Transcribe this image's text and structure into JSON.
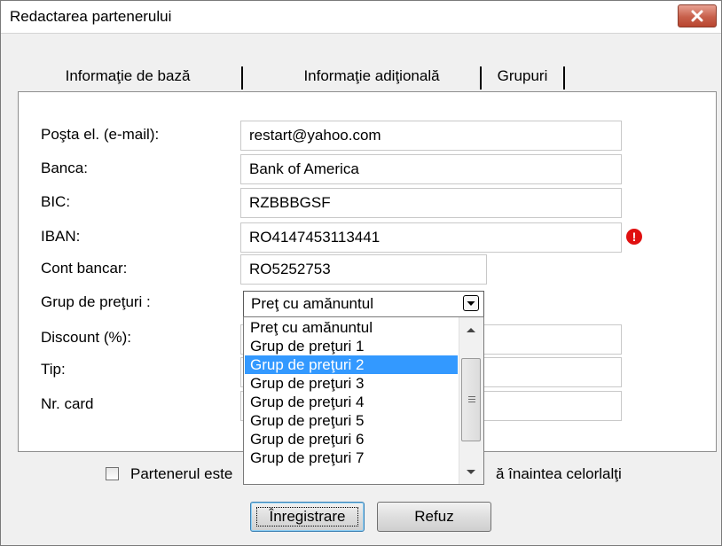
{
  "window": {
    "title": "Redactarea partenerului"
  },
  "tabs": [
    {
      "label": "Informaţie de bază"
    },
    {
      "label": "Informaţie adiţională"
    },
    {
      "label": "Grupuri"
    }
  ],
  "form": {
    "email": {
      "label": "Poşta el. (e-mail):",
      "value": "restart@yahoo.com"
    },
    "bank": {
      "label": "Banca:",
      "value": "Bank of America"
    },
    "bic": {
      "label": "BIC:",
      "value": "RZBBBGSF"
    },
    "iban": {
      "label": "IBAN:",
      "value": "RO4147453113441",
      "error_icon": "!"
    },
    "account": {
      "label": "Cont bancar:",
      "value": "RO5252753"
    },
    "price_group": {
      "label": "Grup de preţuri :",
      "value": "Preţ cu amănuntul"
    },
    "discount": {
      "label": "Discount (%):"
    },
    "type": {
      "label": "Tip:"
    },
    "card": {
      "label": "Nr. card"
    }
  },
  "dropdown": {
    "options": [
      "Preţ cu amănuntul",
      "Grup de preţuri 1",
      "Grup de preţuri 2",
      "Grup de preţuri 3",
      "Grup de preţuri 4",
      "Grup de preţuri 5",
      "Grup de preţuri 6",
      "Grup de preţuri 7"
    ],
    "selected_option": "Grup de preţuri 2"
  },
  "footer": {
    "checkbox_label_left": "Partenerul este",
    "checkbox_label_right": "ă înaintea celorlalţi",
    "save_label": "Înregistrare",
    "cancel_label": "Refuz"
  },
  "colors": {
    "selection": "#3399ff",
    "error": "#e01010",
    "close_button": "#c7604b"
  }
}
